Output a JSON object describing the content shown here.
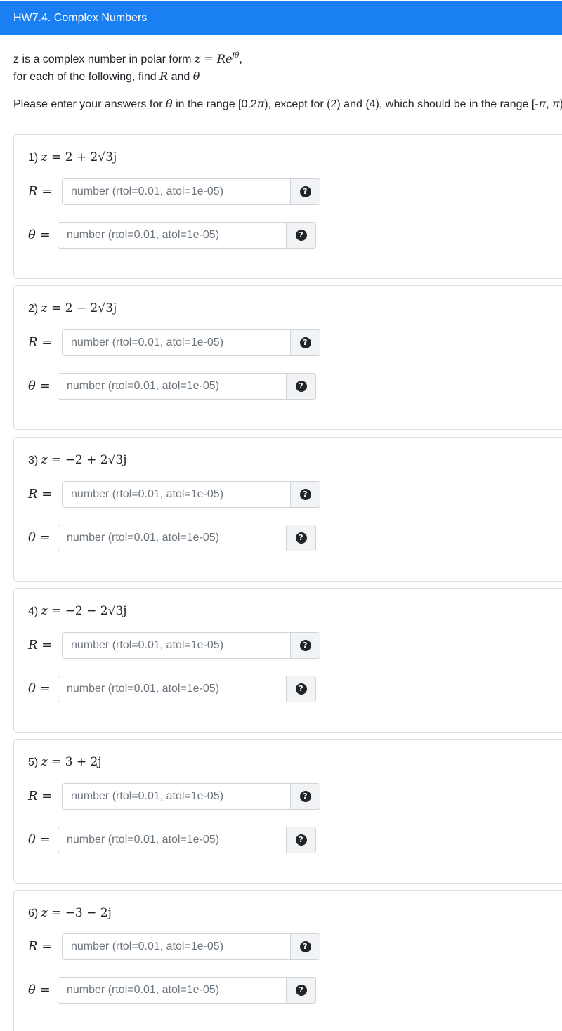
{
  "header": {
    "title": "HW7.4. Complex Numbers"
  },
  "intro": {
    "line1_prefix": "z is a complex number in polar form ",
    "polar_z": "z",
    "polar_eq": " = ",
    "polar_R": "Re",
    "polar_exp": "jθ",
    "line1_suffix": ",",
    "line2_prefix": "for each of the following, find ",
    "line2_R": "R",
    "line2_and": " and ",
    "line2_theta": "θ"
  },
  "instructions": {
    "prefix": "Please enter your answers for ",
    "theta": "θ",
    "middle": " in the range [0,2",
    "pi1": "π",
    "middle2": "), except for (2) and (4), which should be in the range [-",
    "pi2": "π",
    "comma": ", ",
    "pi3": "π",
    "end": ")"
  },
  "labels": {
    "R": "R",
    "theta": "θ",
    "equals": " ="
  },
  "input_placeholder": "number (rtol=0.01, atol=1e-05)",
  "help_icon_glyph": "?",
  "problems": [
    {
      "number": "1) ",
      "z": "z",
      "expr": " = 2 + 2√3j"
    },
    {
      "number": "2) ",
      "z": "z",
      "expr": " = 2 − 2√3j"
    },
    {
      "number": "3) ",
      "z": "z",
      "expr": " = −2 + 2√3j"
    },
    {
      "number": "4) ",
      "z": "z",
      "expr": " = −2 − 2√3j"
    },
    {
      "number": "5) ",
      "z": "z",
      "expr": " = 3 + 2j"
    },
    {
      "number": "6) ",
      "z": "z",
      "expr": " = −3 − 2j"
    }
  ],
  "colors": {
    "header_bg": "#1a7ff2",
    "header_text": "#ffffff",
    "card_border": "#dcdfe3",
    "help_icon_bg": "#212529"
  }
}
